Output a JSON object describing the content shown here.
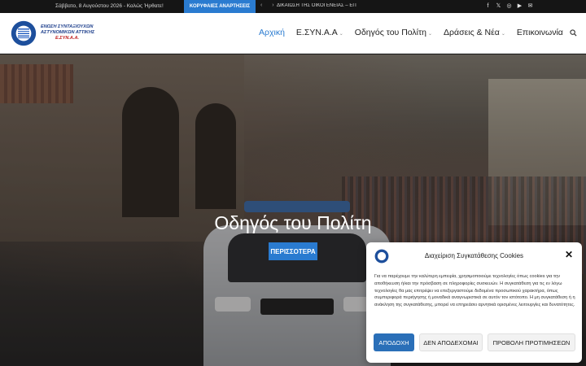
{
  "topbar": {
    "date": "Σάββατο, 8 Αυγούστου 2026 - Καλώς Ήρθατε!",
    "trending_label": "ΚΟΡΥΦΑΙΕΣ ΑΝΑΡΤΗΣΕΙΣ",
    "ticker": "ΔΙΚΑΙΩΣΗ ΤΗΣ ΟΙΚΟΓΕΝΕΙΑΣ – ΕΠ",
    "arrows": "‹ ›",
    "social": [
      "f",
      "𝕏",
      "◎",
      "▶",
      "✉"
    ]
  },
  "logo": {
    "line1": "ΕΝΩΣΗ ΣΥΝΤΑΞΙΟΥΧΩΝ",
    "line2": "ΑΣΤΥΝΟΜΙΚΩΝ ΑΤΤΙΚΗΣ",
    "line3": "Ε.ΣΥΝ.Α.Α."
  },
  "nav": {
    "items": [
      {
        "label": "Αρχική",
        "active": true,
        "caret": ""
      },
      {
        "label": "Ε.ΣΥΝ.Α.Α",
        "active": false,
        "caret": "⌄"
      },
      {
        "label": "Οδηγός του Πολίτη",
        "active": false,
        "caret": "⌄"
      },
      {
        "label": "Δράσεις & Νέα",
        "active": false,
        "caret": "⌄"
      },
      {
        "label": "Επικοινωνία",
        "active": false,
        "caret": ""
      }
    ]
  },
  "hero": {
    "title": "Οδηγός του Πολίτη",
    "button": "ΠΕΡΙΣΣΟΤΕΡΑ"
  },
  "cookie": {
    "title": "Διαχείριση Συγκατάθεσης Cookies",
    "close": "✕",
    "text": "Για να παρέχουμε την καλύτερη εμπειρία, χρησιμοποιούμε τεχνολογίες όπως cookies για την αποθήκευση ή/και την πρόσβαση σε πληροφορίες συσκευών. Η συγκατάθεση για τις εν λόγω τεχνολογίες θα μας επιτρέψει να επεξεργαστούμε δεδομένα προσωπικού χαρακτήρα, όπως συμπεριφορά περιήγησης ή μοναδικά αναγνωριστικά σε αυτόν τον ιστότοπο. Η μη συγκατάθεση ή η ανάκληση της συγκατάθεσης, μπορεί να επηρεάσει αρνητικά ορισμένες λειτουργίες και δυνατότητες.",
    "accept": "ΑΠΟΔΟΧΗ",
    "deny": "ΔΕΝ ΑΠΟΔΕΧΟΜΑΙ",
    "prefs": "ΠΡΟΒΟΛΗ ΠΡΟΤΙΜΗΣΕΩΝ"
  },
  "colors": {
    "accent": "#2a7bd0",
    "topbar": "#151515"
  }
}
